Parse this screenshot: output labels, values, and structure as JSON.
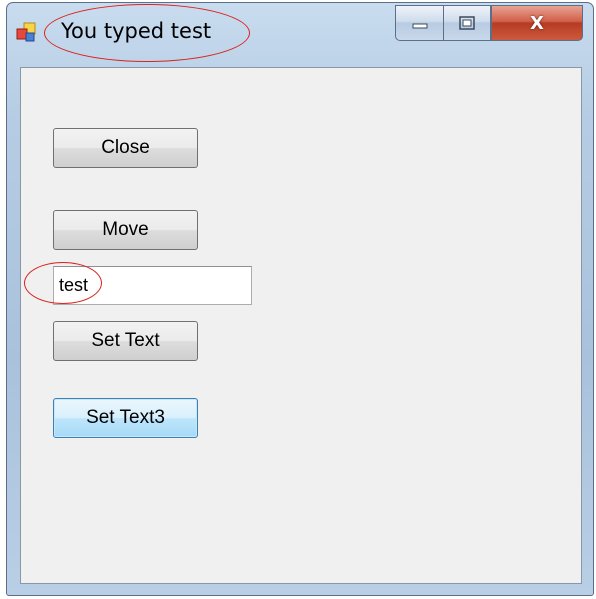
{
  "window": {
    "title": "You typed test",
    "caption_buttons": {
      "minimize_icon": "minimize-icon",
      "maximize_icon": "maximize-icon",
      "close_glyph": "X"
    }
  },
  "buttons": {
    "close": "Close",
    "move": "Move",
    "set_text": "Set Text",
    "set_text3": "Set Text3"
  },
  "textbox": {
    "value": "test"
  },
  "colors": {
    "annotation": "#d9231d",
    "client_background": "#f0f0f0",
    "close_button": "#c8442a",
    "focused_button_border": "#3c7fb1"
  }
}
